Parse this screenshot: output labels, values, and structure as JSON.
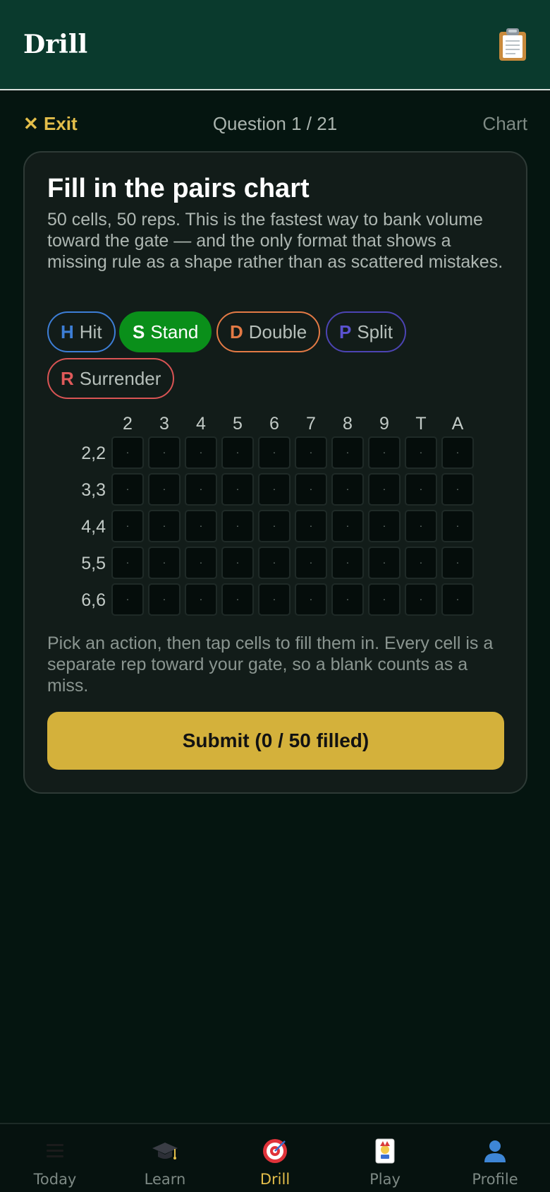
{
  "header": {
    "title": "Drill",
    "icon": "clipboard-icon"
  },
  "subbar": {
    "exit_label": "✕ Exit",
    "question_label": "Question 1 / 21",
    "chart_label": "Chart"
  },
  "card": {
    "title": "Fill in the pairs chart",
    "description": "50 cells, 50 reps. This is the fastest way to bank volume toward the gate — and the only format that shows a missing rule as a shape rather than as scattered mistakes.",
    "actions": [
      {
        "key": "H",
        "label": "Hit",
        "color": "#3d7ed6",
        "selected": false
      },
      {
        "key": "S",
        "label": "Stand",
        "color": "#0a8f1a",
        "selected": true
      },
      {
        "key": "D",
        "label": "Double",
        "color": "#e37a45",
        "selected": false
      },
      {
        "key": "P",
        "label": "Split",
        "color": "#5b52d0",
        "selected": false
      },
      {
        "key": "R",
        "label": "Surrender",
        "color": "#e05a5a",
        "selected": false
      }
    ],
    "grid": {
      "columns": [
        "2",
        "3",
        "4",
        "5",
        "6",
        "7",
        "8",
        "9",
        "T",
        "A"
      ],
      "rows": [
        "2,2",
        "3,3",
        "4,4",
        "5,5",
        "6,6"
      ],
      "empty_marker": "·"
    },
    "hint": "Pick an action, then tap cells to fill them in. Every cell is a separate rep toward your gate, so a blank counts as a miss.",
    "submit_label": "Submit (0 / 50 filled)"
  },
  "bottom_nav": [
    {
      "label": "Today",
      "icon": "menu-icon",
      "active": false
    },
    {
      "label": "Learn",
      "icon": "graduation-cap-icon",
      "active": false
    },
    {
      "label": "Drill",
      "icon": "target-icon",
      "active": true
    },
    {
      "label": "Play",
      "icon": "joker-card-icon",
      "active": false
    },
    {
      "label": "Profile",
      "icon": "person-icon",
      "active": false
    }
  ],
  "colors": {
    "header_bg": "#0a3a2d",
    "page_bg": "#051510",
    "accent_gold": "#d4b13b",
    "exit_gold": "#e3be4a"
  }
}
